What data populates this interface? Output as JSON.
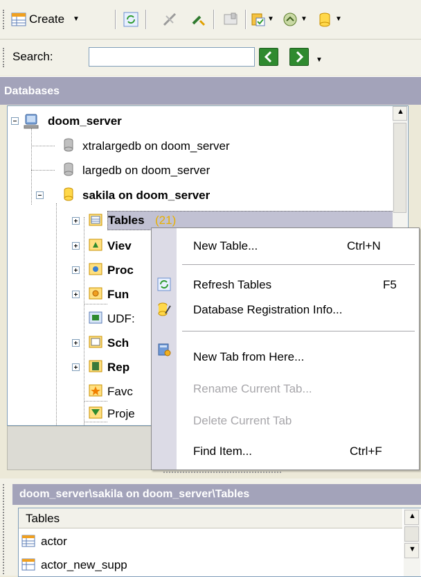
{
  "toolbar": {
    "create_label": "Create",
    "icons": [
      "create-table-icon",
      "refresh-icon",
      "disconnect-icon",
      "connect-icon",
      "properties-icon",
      "register-icon",
      "sql-editor-icon",
      "database-icon"
    ]
  },
  "search": {
    "label": "Search:",
    "value": ""
  },
  "databases_panel": {
    "title": "Databases",
    "tree": [
      {
        "label": "doom_server",
        "level": 0,
        "bold": true,
        "expanded": true,
        "icon": "server-icon"
      },
      {
        "label": "xtralargedb on doom_server",
        "level": 1,
        "bold": false,
        "icon": "database-gray-icon"
      },
      {
        "label": "largedb on doom_server",
        "level": 1,
        "bold": false,
        "icon": "database-gray-icon"
      },
      {
        "label": "sakila on doom_server",
        "level": 1,
        "bold": true,
        "expanded": true,
        "icon": "database-yellow-icon"
      },
      {
        "label": "Tables",
        "count": "(21)",
        "level": 2,
        "bold": true,
        "selected": true,
        "icon": "tables-icon"
      },
      {
        "label": "Viev",
        "level": 2,
        "bold": true,
        "icon": "views-icon"
      },
      {
        "label": "Proc",
        "level": 2,
        "bold": true,
        "icon": "procedures-icon"
      },
      {
        "label": "Fun",
        "level": 2,
        "bold": true,
        "icon": "functions-icon"
      },
      {
        "label": "UDF:",
        "level": 2,
        "bold": false,
        "icon": "udf-icon"
      },
      {
        "label": "Sch",
        "level": 2,
        "bold": true,
        "icon": "schema-icon"
      },
      {
        "label": "Rep",
        "level": 2,
        "bold": true,
        "icon": "reports-icon"
      },
      {
        "label": "Favc",
        "level": 2,
        "bold": false,
        "icon": "favorites-icon"
      },
      {
        "label": "Proje",
        "level": 2,
        "bold": false,
        "icon": "projects-icon"
      }
    ]
  },
  "context_menu": {
    "items": [
      {
        "label": "New Table...",
        "shortcut": "Ctrl+N",
        "enabled": true,
        "icon": null
      },
      {
        "label": "Refresh Tables",
        "shortcut": "F5",
        "enabled": true,
        "icon": "refresh-icon"
      },
      {
        "label": "Database Registration Info...",
        "shortcut": "",
        "enabled": true,
        "icon": "registration-info-icon"
      },
      {
        "label": "New Tab from Here...",
        "shortcut": "",
        "enabled": true,
        "icon": "new-tab-icon"
      },
      {
        "label": "Rename Current Tab...",
        "shortcut": "",
        "enabled": false,
        "icon": null
      },
      {
        "label": "Delete Current Tab",
        "shortcut": "",
        "enabled": false,
        "icon": null
      },
      {
        "label": "Find Item...",
        "shortcut": "Ctrl+F",
        "enabled": true,
        "icon": null
      }
    ]
  },
  "bottom_panel": {
    "path": "doom_server\\sakila on doom_server\\Tables",
    "column_header": "Tables",
    "rows": [
      "actor",
      "actor_new_supp"
    ]
  },
  "colors": {
    "panel_header": "#a3a3ba",
    "selection": "#c1c1d3",
    "menu_left_strip": "#dcdbe6",
    "disabled_text": "#a7a6aa",
    "count_text": "#e8b000"
  }
}
